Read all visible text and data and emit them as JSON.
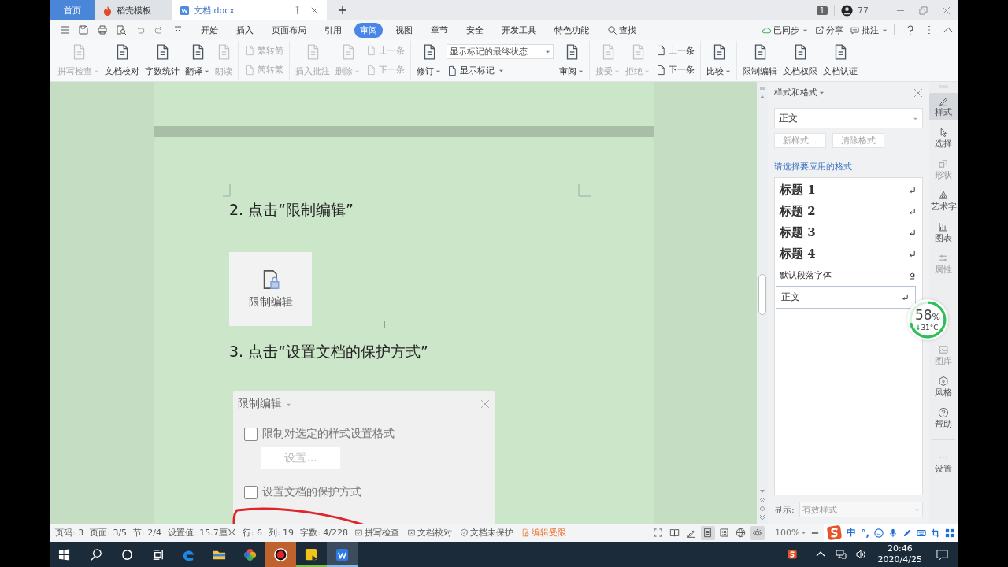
{
  "titlebar": {
    "tabs": [
      {
        "label": "首页",
        "kind": "home",
        "selected": false
      },
      {
        "label": "稻壳模板",
        "kind": "template",
        "selected": false
      },
      {
        "label": "文档.docx",
        "kind": "doc",
        "selected": true
      }
    ],
    "badge": "1",
    "user_count": "77"
  },
  "menu": {
    "tabs": [
      {
        "label": "开始",
        "selected": false
      },
      {
        "label": "插入",
        "selected": false
      },
      {
        "label": "页面布局",
        "selected": false
      },
      {
        "label": "引用",
        "selected": false
      },
      {
        "label": "审阅",
        "selected": true
      },
      {
        "label": "视图",
        "selected": false
      },
      {
        "label": "章节",
        "selected": false
      },
      {
        "label": "安全",
        "selected": false
      },
      {
        "label": "开发工具",
        "selected": false
      },
      {
        "label": "特色功能",
        "selected": false
      }
    ],
    "search": "查找",
    "actions": [
      {
        "label": "已同步",
        "kind": "cloud",
        "dropdown": true
      },
      {
        "label": "分享",
        "kind": "share",
        "dropdown": false
      },
      {
        "label": "批注",
        "kind": "comment",
        "dropdown": true
      }
    ]
  },
  "ribbon": {
    "groups": [
      {
        "items": [
          {
            "kind": "big",
            "label": "拼写检查",
            "dropdown": true,
            "disabled": true
          },
          {
            "kind": "big",
            "label": "文档校对",
            "dropdown": false,
            "disabled": false
          },
          {
            "kind": "big",
            "label": "字数统计",
            "dropdown": false,
            "disabled": false
          },
          {
            "kind": "big",
            "label": "翻译",
            "dropdown": true,
            "disabled": false
          },
          {
            "kind": "big",
            "label": "朗读",
            "dropdown": false,
            "disabled": true
          }
        ]
      },
      {
        "items": [
          {
            "kind": "stack",
            "rows": [
              {
                "kind": "small",
                "label": "繁转简",
                "dropdown": false,
                "disabled": true
              },
              {
                "kind": "small",
                "label": "简转繁",
                "dropdown": false,
                "disabled": true
              }
            ]
          }
        ]
      },
      {
        "items": [
          {
            "kind": "big",
            "label": "插入批注",
            "dropdown": false,
            "disabled": true
          },
          {
            "kind": "big",
            "label": "删除",
            "dropdown": true,
            "disabled": true
          },
          {
            "kind": "stack",
            "rows": [
              {
                "kind": "small",
                "label": "上一条",
                "dropdown": false,
                "disabled": true
              },
              {
                "kind": "small",
                "label": "下一条",
                "dropdown": false,
                "disabled": true
              }
            ]
          }
        ]
      },
      {
        "items": [
          {
            "kind": "big",
            "label": "修订",
            "dropdown": true,
            "disabled": false
          },
          {
            "kind": "stack",
            "rows": [
              {
                "kind": "select",
                "label": "显示标记的最终状态",
                "dropdown": true,
                "disabled": false
              },
              {
                "kind": "small",
                "label": "显示标记",
                "dropdown": true,
                "disabled": false
              }
            ]
          },
          {
            "kind": "big",
            "label": "审阅",
            "dropdown": true,
            "disabled": false
          }
        ]
      },
      {
        "items": [
          {
            "kind": "big",
            "label": "接受",
            "dropdown": true,
            "disabled": true
          },
          {
            "kind": "big",
            "label": "拒绝",
            "dropdown": true,
            "disabled": true
          },
          {
            "kind": "stack",
            "rows": [
              {
                "kind": "small",
                "label": "上一条",
                "dropdown": false,
                "disabled": false
              },
              {
                "kind": "small",
                "label": "下一条",
                "dropdown": false,
                "disabled": false
              }
            ]
          }
        ]
      },
      {
        "items": [
          {
            "kind": "big",
            "label": "比较",
            "dropdown": true,
            "disabled": false
          }
        ]
      },
      {
        "items": [
          {
            "kind": "big",
            "label": "限制编辑",
            "dropdown": false,
            "disabled": false
          },
          {
            "kind": "big",
            "label": "文档权限",
            "dropdown": false,
            "disabled": false
          },
          {
            "kind": "big",
            "label": "文档认证",
            "dropdown": false,
            "disabled": false
          }
        ]
      }
    ]
  },
  "document": {
    "step_2": "2. 点击“限制编辑”",
    "figure_1": {
      "label": "限制编辑"
    },
    "step_3": "3. 点击“设置文档的保护方式”",
    "figure_2": {
      "title": "限制编辑",
      "options": [
        {
          "label": "限制对选定的样式设置格式",
          "checked": false
        },
        {
          "label": "设置文档的保护方式",
          "checked": false
        }
      ],
      "button": "设置..."
    }
  },
  "styles_panel": {
    "title": "样式和格式",
    "current": "正文",
    "buttons": [
      {
        "label": "新样式...",
        "disabled": true
      },
      {
        "label": "清除格式",
        "disabled": true
      }
    ],
    "prompt": "请选择要应用的格式",
    "styles": [
      {
        "label": "标题 1",
        "kind": "heading",
        "selected": false
      },
      {
        "label": "标题 2",
        "kind": "heading",
        "selected": false
      },
      {
        "label": "标题 3",
        "kind": "heading",
        "selected": false
      },
      {
        "label": "标题 4",
        "kind": "heading",
        "selected": false
      },
      {
        "label": "默认段落字体",
        "kind": "character",
        "selected": false
      },
      {
        "label": "正文",
        "kind": "paragraph",
        "selected": true
      }
    ],
    "show_label": "显示:",
    "show_value": "有效样式"
  },
  "sidebar": [
    {
      "label": "样式",
      "kind": "pen",
      "selected": true,
      "disabled": false
    },
    {
      "label": "选择",
      "kind": "cursor",
      "selected": false,
      "disabled": false
    },
    {
      "label": "形状",
      "kind": "shape",
      "selected": false,
      "disabled": true
    },
    {
      "label": "艺术字",
      "kind": "art",
      "selected": false,
      "disabled": false
    },
    {
      "label": "图表",
      "kind": "chart",
      "selected": false,
      "disabled": false
    },
    {
      "label": "属性",
      "kind": "sliders",
      "selected": false,
      "disabled": true
    },
    {
      "label": "图库",
      "kind": "image",
      "selected": false,
      "disabled": true
    },
    {
      "label": "风格",
      "kind": "hexagon",
      "selected": false,
      "disabled": false
    },
    {
      "label": "帮助",
      "kind": "help",
      "selected": false,
      "disabled": false
    },
    {
      "label": "设置",
      "kind": "more",
      "selected": false,
      "disabled": false
    }
  ],
  "monitor": {
    "value": "58",
    "unit": "%",
    "temperature": "31°C"
  },
  "status_bar": {
    "fields": [
      "页码: 3",
      "页面: 3/5",
      "节: 2/4",
      "设置值: 15.7厘米",
      "行: 6",
      "列: 19",
      "字数: 4/228"
    ],
    "actions": [
      {
        "label": "拼写检查",
        "kind": "spell",
        "warning": false
      },
      {
        "label": "文档校对",
        "kind": "proof",
        "warning": false
      },
      {
        "label": "文档未保护",
        "kind": "shield",
        "warning": false
      },
      {
        "label": "编辑受限",
        "kind": "lockdoc",
        "warning": true
      }
    ],
    "views": [
      {
        "kind": "fullscreen",
        "selected": false
      },
      {
        "kind": "book",
        "selected": false
      },
      {
        "kind": "pen",
        "selected": false
      },
      {
        "kind": "page",
        "selected": true
      },
      {
        "kind": "outline",
        "selected": false
      },
      {
        "kind": "web",
        "selected": false
      },
      {
        "kind": "eye",
        "selected": true
      }
    ],
    "zoom": "100%"
  },
  "ime": {
    "mode": "中",
    "punctuation": "°,"
  },
  "taskbar": {
    "apps": [
      {
        "kind": "search",
        "active": false
      },
      {
        "kind": "cortana",
        "active": false
      },
      {
        "kind": "taskview",
        "active": false
      },
      {
        "kind": "edge",
        "active": false
      },
      {
        "kind": "explorer",
        "active": false
      },
      {
        "kind": "colorwheel",
        "active": false
      },
      {
        "kind": "recorder",
        "active": false
      },
      {
        "kind": "player",
        "active": false
      },
      {
        "kind": "wps",
        "active": true
      }
    ],
    "time": "20:46",
    "date": "2020/4/25"
  }
}
